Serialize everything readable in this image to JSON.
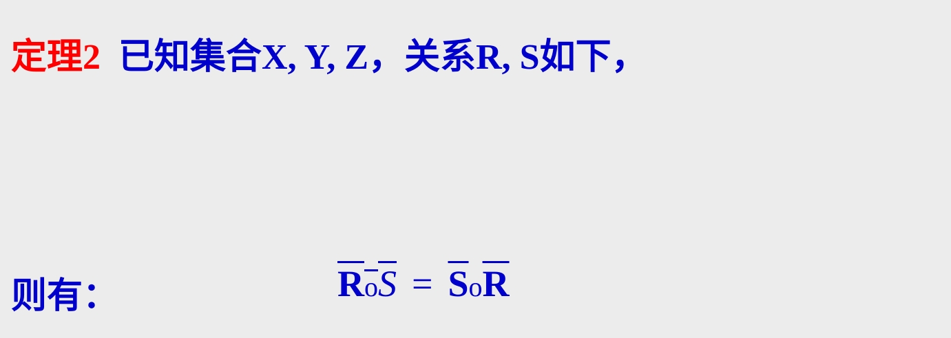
{
  "theorem_label": "定理2",
  "theorem_text": "已知集合X, Y, Z，关系R, S如下，",
  "conclusion_label": "则有：",
  "formula": {
    "lhs_R": "R",
    "lhs_op": "o",
    "lhs_S": "S",
    "equals": "=",
    "rhs_S": "S",
    "rhs_op": "o",
    "rhs_R": "R"
  },
  "colors": {
    "label": "#ff0000",
    "text": "#0000cc",
    "background": "#ececec"
  }
}
